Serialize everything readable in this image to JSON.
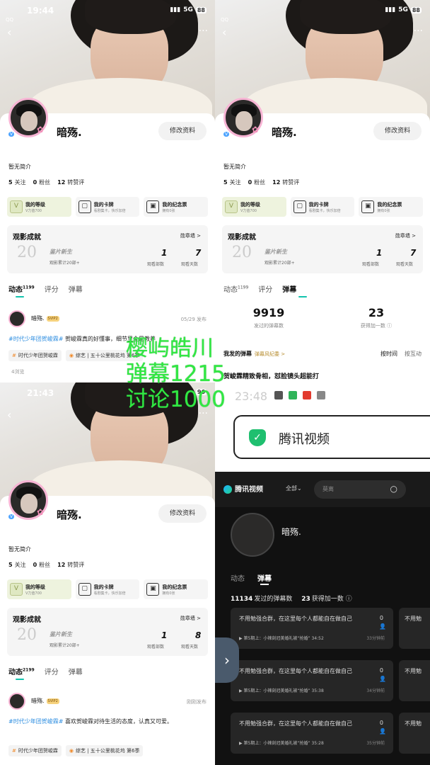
{
  "panels": [
    {
      "status": {
        "time": "19:44",
        "network": "5G",
        "battery": "88",
        "qq": "QQ"
      },
      "username": "暗殇.",
      "edit_label": "修改资料",
      "bio": "暂无简介",
      "stats": [
        {
          "num": "5",
          "label": "关注"
        },
        {
          "num": "0",
          "label": "粉丝"
        },
        {
          "num": "12",
          "label": "转赞评"
        }
      ],
      "cards": [
        {
          "t1": "我的等级",
          "t2": "V力值700",
          "icon": "V"
        },
        {
          "t1": "我的卡牌",
          "t2": "看剧集卡，快乐加倍",
          "icon": "▢"
        },
        {
          "t1": "我的纪念票",
          "t2": "拥有0张",
          "icon": "▣"
        }
      ],
      "achievement": {
        "title": "观影成就",
        "wall": "勋章墙 >",
        "badge": "鉴片新生",
        "sub": "观影累计20部+",
        "watched": "1",
        "watched_label": "观看部数",
        "days": "7",
        "days_label": "观看天数"
      },
      "tabs": [
        {
          "label": "动态",
          "count": "1199"
        },
        {
          "label": "评分"
        },
        {
          "label": "弹幕"
        }
      ],
      "active_tab": 0,
      "post": {
        "user": "暗殇.",
        "svip": "SVIP2",
        "date": "05/29 发布",
        "tag": "#时代少年团贺峻霖#",
        "text": " 贺峻霖真的好懂事，细节里全是教养",
        "chip1": "时代少年团贺峻霖",
        "chip2": "综艺 | 五十公里桃花坞 第6季",
        "views": "4浏览"
      }
    },
    {
      "status": {
        "time": "",
        "network": "5G",
        "battery": "88",
        "qq": "QQ"
      },
      "username": "暗殇.",
      "edit_label": "修改资料",
      "bio": "暂无简介",
      "stats": [
        {
          "num": "5",
          "label": "关注"
        },
        {
          "num": "0",
          "label": "粉丝"
        },
        {
          "num": "12",
          "label": "转赞评"
        }
      ],
      "cards": [
        {
          "t1": "我的等级",
          "t2": "V力值700",
          "icon": "V"
        },
        {
          "t1": "我的卡牌",
          "t2": "看剧集卡，快乐加倍",
          "icon": "▢"
        },
        {
          "t1": "我的纪念票",
          "t2": "拥有0张",
          "icon": "▣"
        }
      ],
      "achievement": {
        "title": "观影成就",
        "wall": "勋章墙 >",
        "badge": "鉴片新生",
        "sub": "观影累计20部+",
        "watched": "1",
        "watched_label": "观看部数",
        "days": "7",
        "days_label": "观看天数"
      },
      "tabs": [
        {
          "label": "动态",
          "count": "1199"
        },
        {
          "label": "评分"
        },
        {
          "label": "弹幕"
        }
      ],
      "active_tab": 2,
      "danmaku": {
        "sent": "9919",
        "sent_label": "发过的弹幕数",
        "likes": "23",
        "likes_label": "获得加一数",
        "head": "我发的弹幕",
        "fav": "弹幕风纪委 >",
        "sort_time": "按时间",
        "sort_hot": "按互动",
        "first": "贺峻霖精致骨相，怼脸镜头超能打"
      }
    },
    {
      "status": {
        "time": "21:43",
        "network": "",
        "battery": "96",
        "qq": ""
      },
      "username": "暗殇.",
      "edit_label": "修改资料",
      "bio": "暂无简介",
      "stats": [
        {
          "num": "5",
          "label": "关注"
        },
        {
          "num": "0",
          "label": "粉丝"
        },
        {
          "num": "12",
          "label": "转赞评"
        }
      ],
      "cards": [
        {
          "t1": "我的等级",
          "t2": "V力值700",
          "icon": "V"
        },
        {
          "t1": "我的卡牌",
          "t2": "看剧集卡，快乐加倍",
          "icon": "▢"
        },
        {
          "t1": "我的纪念票",
          "t2": "拥有0张",
          "icon": "▣"
        }
      ],
      "achievement": {
        "title": "观影成就",
        "wall": "勋章墙 >",
        "badge": "鉴片新生",
        "sub": "观影累计20部+",
        "watched": "1",
        "watched_label": "观看部数",
        "days": "8",
        "days_label": "观看天数"
      },
      "tabs": [
        {
          "label": "动态",
          "count": "2199"
        },
        {
          "label": "评分"
        },
        {
          "label": "弹幕"
        }
      ],
      "active_tab": 0,
      "post": {
        "user": "暗殇.",
        "svip": "SVIP2",
        "date": "刚刚发布",
        "tag": "#时代少年团贺峻霖#",
        "text": " 喜欢贺峻霖对待生活的态度，认真又可爱。",
        "chip1": "时代少年团贺峻霖",
        "chip2": "综艺 | 五十公里桃花坞 第6季",
        "views": ""
      }
    }
  ],
  "tencent": {
    "time": "23:48",
    "toast": "腾讯视频",
    "app_name": "腾讯视频",
    "all": "全部",
    "search_placeholder": "莫离",
    "username": "暗殇.",
    "tabs": [
      "动态",
      "弹幕"
    ],
    "sent": "11134",
    "sent_label": "发过的弹幕数",
    "likes": "23",
    "likes_label": "获得加一数",
    "items": [
      {
        "text": "不用勉强合群，在这里每个人都能自在做自己",
        "count": "0",
        "ep": "第5期上：小辣刻冠美婚礼被“抢婚” 34:52",
        "ago": "33分钟前"
      },
      {
        "text": "不用勉强合群，在这里每个人都能自在做自己",
        "count": "0",
        "ep": "第5期上：小辣刻冠美婚礼被“抢婚” 35:38",
        "ago": "34分钟前"
      },
      {
        "text": "不用勉强合群，在这里每个人都能自在做自己",
        "count": "0",
        "ep": "第5期上：小辣刻冠美婚礼被“抢婚” 35:28",
        "ago": "35分钟前"
      }
    ],
    "side_text": "不用勉"
  },
  "overlay": {
    "line1": "樱屿皓川",
    "line2": "弹幕1215",
    "line3": "讨论1000"
  },
  "colors": {
    "accent": "#12c3ad",
    "overlay": "#31e843",
    "avatar_ring": "#f7b4d4"
  }
}
